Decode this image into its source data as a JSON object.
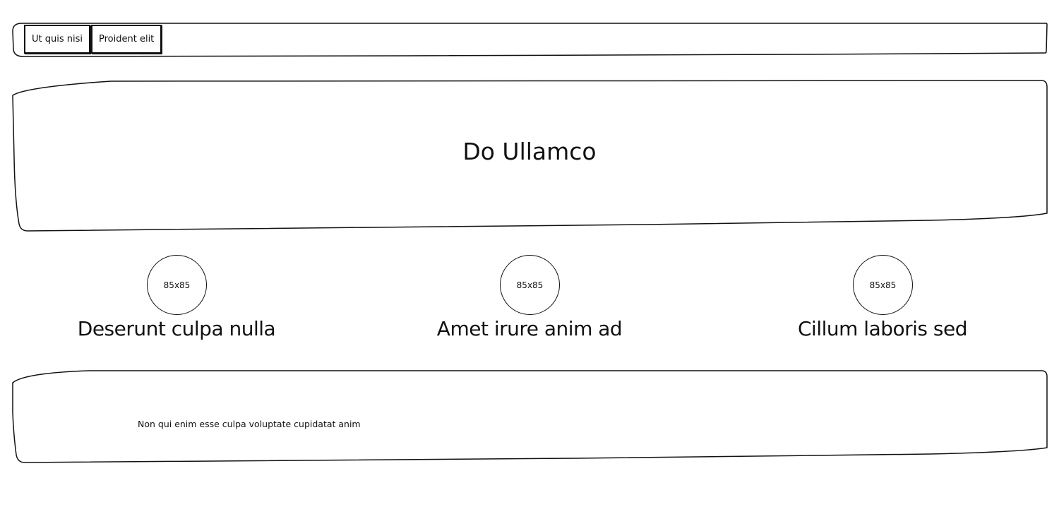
{
  "nav": {
    "tabs": [
      {
        "label": "Ut quis nisi"
      },
      {
        "label": "Proident elit"
      }
    ]
  },
  "hero": {
    "title": "Do Ullamco"
  },
  "features": [
    {
      "image_placeholder": "85x85",
      "title": "Deserunt culpa nulla"
    },
    {
      "image_placeholder": "85x85",
      "title": "Amet irure anim ad"
    },
    {
      "image_placeholder": "85x85",
      "title": "Cillum laboris sed"
    }
  ],
  "footer": {
    "text": "Non qui enim esse culpa voluptate cupidatat anim"
  },
  "colors": {
    "stroke": "#111111",
    "background": "#ffffff"
  }
}
